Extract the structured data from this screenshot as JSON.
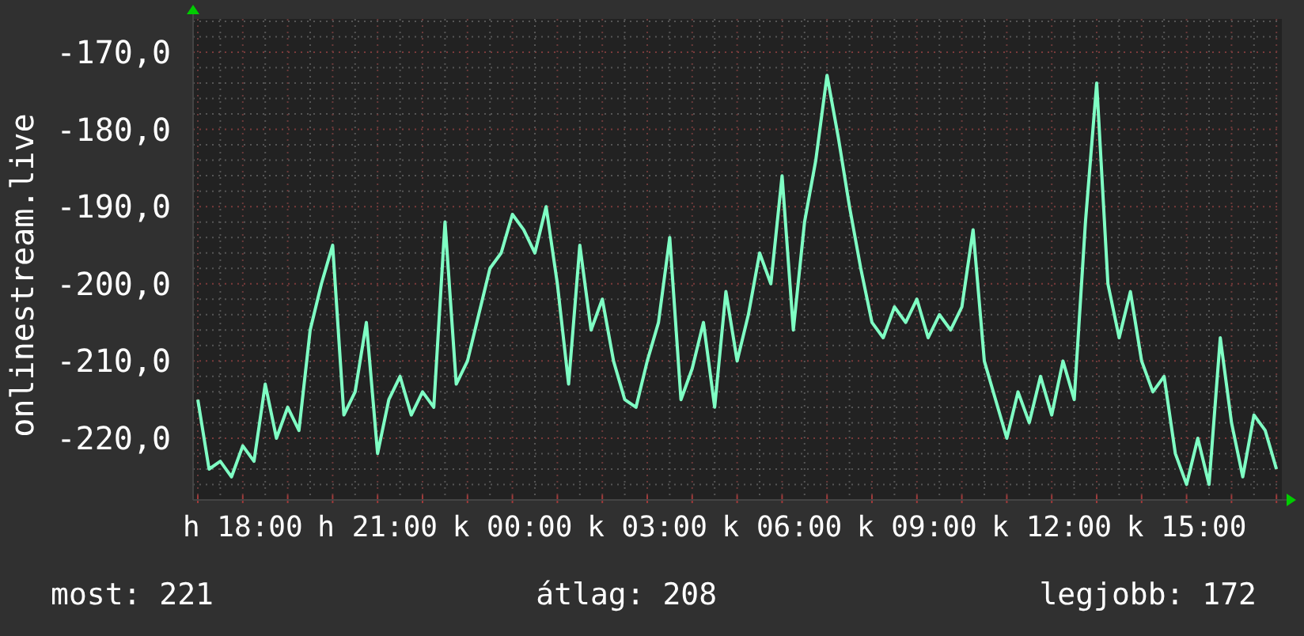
{
  "graph": {
    "chart_data": {
      "type": "line",
      "ylabel": "onlinestream.live",
      "categories": [
        null,
        null,
        null,
        null,
        "h 18:00",
        null,
        null,
        null,
        null,
        null,
        null,
        null,
        null,
        null,
        null,
        null,
        "h 21:00",
        null,
        null,
        null,
        null,
        null,
        null,
        null,
        null,
        null,
        null,
        null,
        "k 00:00",
        null,
        null,
        null,
        null,
        null,
        null,
        null,
        null,
        null,
        null,
        null,
        "k 03:00",
        null,
        null,
        null,
        null,
        null,
        null,
        null,
        null,
        null,
        null,
        null,
        "k 06:00",
        null,
        null,
        null,
        null,
        null,
        null,
        null,
        null,
        null,
        null,
        null,
        "k 09:00",
        null,
        null,
        null,
        null,
        null,
        null,
        null,
        null,
        null,
        null,
        null,
        "k 12:00",
        null,
        null,
        null,
        null,
        null,
        null,
        null,
        null,
        null,
        null,
        null,
        "k 15:00",
        null,
        null,
        null,
        null,
        null,
        null,
        null,
        null
      ],
      "grid": true,
      "series": [
        {
          "color": "#7fffc4",
          "values": [
            -215,
            -224,
            -223,
            -225,
            -221,
            -223,
            -213,
            -220,
            -216,
            -219,
            -206,
            -200,
            -195,
            -217,
            -214,
            -205,
            -222,
            -215,
            -212,
            -217,
            -214,
            -216,
            -192,
            -213,
            -210,
            -204,
            -198,
            -196,
            -191,
            -193,
            -196,
            -190,
            -200,
            -213,
            -195,
            -206,
            -202,
            -210,
            -215,
            -216,
            -210,
            -205,
            -194,
            -215,
            -211,
            -205,
            -216,
            -201,
            -210,
            -204,
            -196,
            -200,
            -186,
            -206,
            -192,
            -184,
            -173,
            -181,
            -190,
            -198,
            -205,
            -207,
            -203,
            -205,
            -202,
            -207,
            -204,
            -206,
            -203,
            -193,
            -210,
            -215,
            -220,
            -214,
            -218,
            -212,
            -217,
            -210,
            -215,
            -192,
            -174,
            -200,
            -207,
            -201,
            -210,
            -214,
            -212,
            -222,
            -226,
            -220,
            -226,
            -207,
            -218,
            -225,
            -217,
            -219,
            -224
          ]
        }
      ],
      "ylim": [
        -228,
        -165.7
      ],
      "yticks": [
        {
          "value": -220,
          "label": "-220,0"
        },
        {
          "value": -210,
          "label": "-210,0"
        },
        {
          "value": -200,
          "label": "-200,0"
        },
        {
          "value": -190,
          "label": "-190,0"
        },
        {
          "value": -180,
          "label": "-180,0"
        },
        {
          "value": -170,
          "label": "-170,0"
        }
      ]
    }
  },
  "footer": [
    "most: 221",
    "átlag: 208",
    "legjobb: 172"
  ]
}
